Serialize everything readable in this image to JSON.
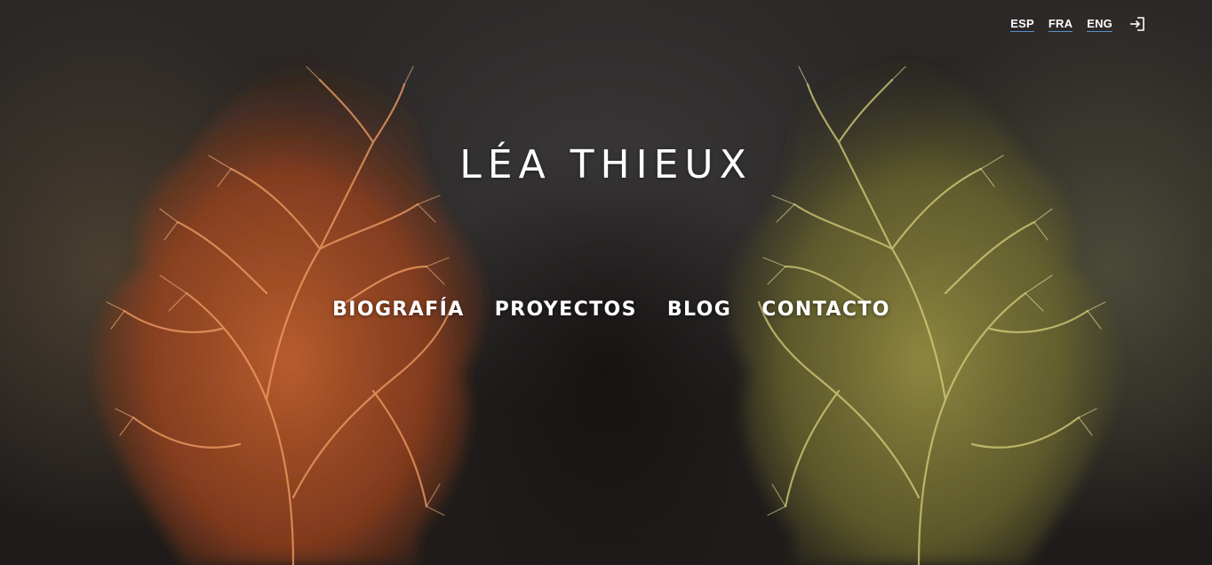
{
  "header": {
    "languages": [
      {
        "label": "ESP"
      },
      {
        "label": "FRA"
      },
      {
        "label": "ENG"
      }
    ],
    "login_icon": "login-icon"
  },
  "hero": {
    "title": "LÉA THIEUX",
    "background": "mirrored coral-like branching artwork, orange on left, olive-green on right, dark textured backdrop"
  },
  "nav": {
    "items": [
      {
        "label": "BIOGRAFÍA"
      },
      {
        "label": "PROYECTOS"
      },
      {
        "label": "BLOG"
      },
      {
        "label": "CONTACTO"
      }
    ]
  },
  "colors": {
    "text": "#ffffff",
    "link_underline": "#5a8fcf",
    "coral_left": "#e8834a",
    "coral_right": "#c9c070",
    "background": "#232020"
  }
}
